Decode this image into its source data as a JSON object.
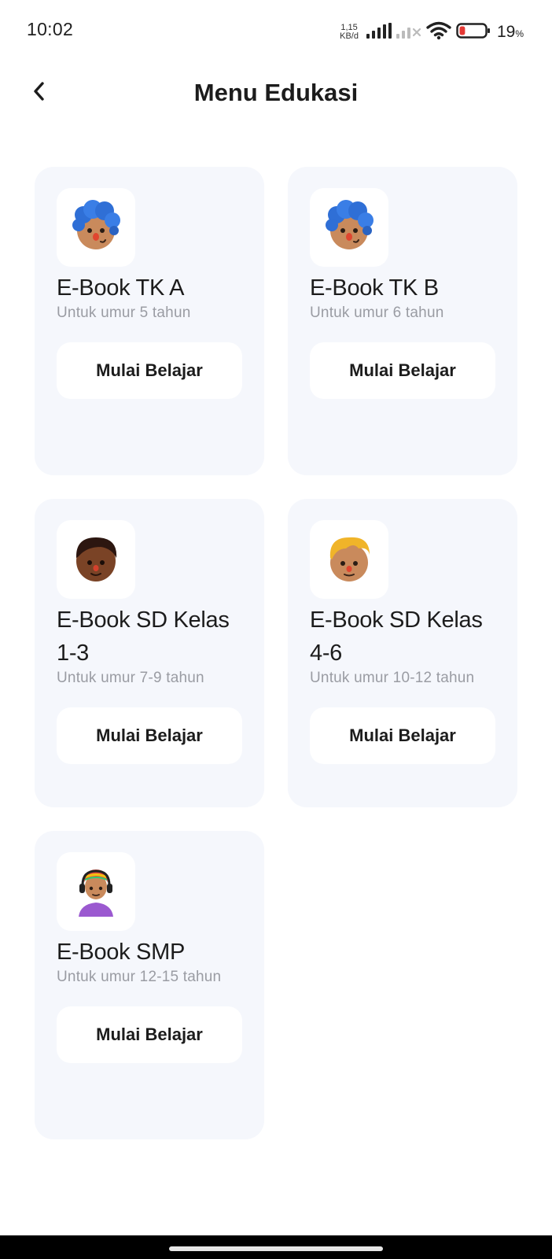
{
  "status_bar": {
    "time": "10:02",
    "net_speed_value": "1,15",
    "net_speed_unit": "KB/d",
    "battery_value": "19",
    "battery_unit": "%",
    "battery_level": 0.19,
    "icons": [
      "signal-icon",
      "signal-no-sim-icon",
      "wifi-icon",
      "battery-low-icon"
    ]
  },
  "header": {
    "back_icon": "chevron-left-icon",
    "title": "Menu Edukasi"
  },
  "cards": [
    {
      "avatar": "blue-curly-hair-avatar",
      "title": "E-Book TK A",
      "subtitle": "Untuk umur 5 tahun",
      "button": "Mulai Belajar"
    },
    {
      "avatar": "blue-curly-hair-avatar",
      "title": "E-Book TK B",
      "subtitle": "Untuk umur 6 tahun",
      "button": "Mulai Belajar"
    },
    {
      "avatar": "dark-hair-avatar",
      "title": "E-Book SD Kelas 1-3",
      "subtitle": "Untuk umur 7-9 tahun",
      "button": "Mulai Belajar"
    },
    {
      "avatar": "blonde-hair-avatar",
      "title": "E-Book SD Kelas 4-6",
      "subtitle": "Untuk umur 10-12 tahun",
      "button": "Mulai Belajar"
    },
    {
      "avatar": "rainbow-hair-headphones-avatar",
      "title": "E-Book SMP",
      "subtitle": "Untuk umur 12-15 tahun",
      "button": "Mulai Belajar"
    }
  ],
  "colors": {
    "card_background": "#f5f7fc",
    "subtitle": "#9a9ca3",
    "battery_low": "#e53935"
  }
}
